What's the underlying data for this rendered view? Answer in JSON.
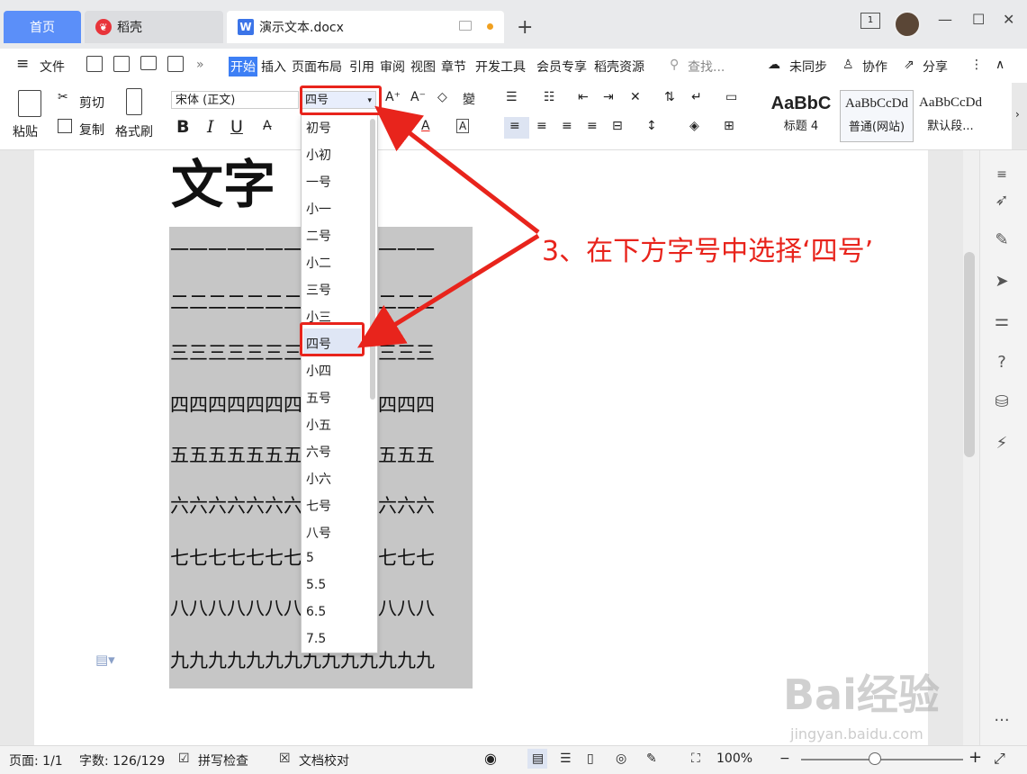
{
  "tabs": {
    "home": "首页",
    "daoke": "稻壳",
    "doc": "演示文本.docx",
    "add": "+"
  },
  "window": {
    "page_badge": "1",
    "minimize": "—",
    "maximize": "☐",
    "close": "✕"
  },
  "menu": {
    "hamburger": "≡",
    "file": "文件",
    "more": "»",
    "start": "开始",
    "insert": "插入",
    "layout": "页面布局",
    "reference": "引用",
    "review": "审阅",
    "view": "视图",
    "chapter": "章节",
    "devtools": "开发工具",
    "member": "会员专享",
    "daoke_res": "稻壳资源",
    "search": "查找...",
    "sync": "未同步",
    "collab": "协作",
    "share": "分享",
    "kebab": "⋮",
    "collapse": "∧"
  },
  "ribbon": {
    "paste": "粘贴",
    "cut": "剪切",
    "copy": "复制",
    "format_painter": "格式刷",
    "font_name": "宋体 (正文)",
    "font_size": "四号",
    "bold": "B",
    "italic": "I",
    "underline": "U",
    "styles": [
      {
        "sample": "AaBbC",
        "label": "标题 4"
      },
      {
        "sample": "AaBbCcDd",
        "label": "普通(网站)"
      },
      {
        "sample": "AaBbCcDd",
        "label": "默认段..."
      }
    ]
  },
  "font_size_options": [
    "初号",
    "小初",
    "一号",
    "小一",
    "二号",
    "小二",
    "三号",
    "小三",
    "四号",
    "小四",
    "五号",
    "小五",
    "六号",
    "小六",
    "七号",
    "八号",
    "5",
    "5.5",
    "6.5",
    "7.5"
  ],
  "selected_font_size": "四号",
  "document": {
    "title": "文字",
    "rows": [
      "一一一一一一一一一一一一一一",
      "二二二二二二二二二二二二二二",
      "三三三三三三三三三三三三三三",
      "四四四四四四四四四四四四四四",
      "五五五五五五五五五五五五五五",
      "六六六六六六六六六六六六六六",
      "七七七七七七七七七七七七七七",
      "八八八八八八八八八八八八八八",
      "九九九九九九九九九九九九九九"
    ]
  },
  "annotation": "3、在下方字号中选择‘四号’",
  "status": {
    "page": "页面: 1/1",
    "words": "字数: 126/129",
    "spellcheck": "拼写检查",
    "proofread": "文档校对",
    "zoom": "100%",
    "minus": "−",
    "plus": "+"
  },
  "watermark": {
    "main": "Bai经验",
    "sub": "jingyan.baidu.com"
  },
  "colors": {
    "accent_blue": "#3d7ff5",
    "annotation_red": "#e8241c",
    "table_gray": "#c6c6c6"
  }
}
